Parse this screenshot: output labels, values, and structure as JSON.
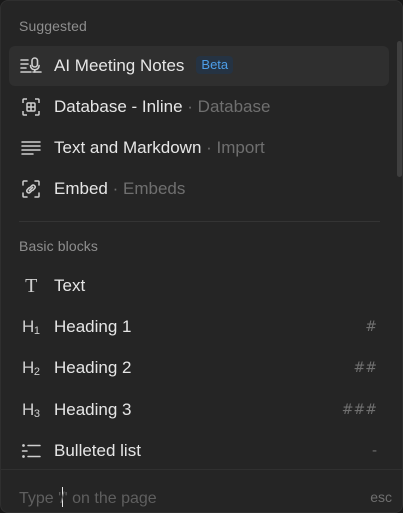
{
  "sections": {
    "suggested": "Suggested",
    "basic_blocks": "Basic blocks"
  },
  "suggested_items": [
    {
      "label": "AI Meeting Notes",
      "badge": "Beta",
      "icon": "meeting-notes-icon"
    },
    {
      "label": "Database - Inline",
      "separator": "·",
      "meta": "Database",
      "icon": "database-inline-icon"
    },
    {
      "label": "Text and Markdown",
      "separator": "·",
      "meta": "Import",
      "icon": "lines-icon"
    },
    {
      "label": "Embed",
      "separator": "·",
      "meta": "Embeds",
      "icon": "embed-link-icon"
    }
  ],
  "basic_items": [
    {
      "label": "Text",
      "icon_text": "T",
      "shortcut": "",
      "icon": "text-icon"
    },
    {
      "label": "Heading 1",
      "icon_text": "H",
      "icon_sub": "1",
      "shortcut": "#",
      "icon": "heading-1-icon"
    },
    {
      "label": "Heading 2",
      "icon_text": "H",
      "icon_sub": "2",
      "shortcut": "##",
      "icon": "heading-2-icon"
    },
    {
      "label": "Heading 3",
      "icon_text": "H",
      "icon_sub": "3",
      "shortcut": "###",
      "icon": "heading-3-icon"
    },
    {
      "label": "Bulleted list",
      "shortcut": "-",
      "icon": "bulleted-list-icon"
    }
  ],
  "footer": {
    "hint_before": "Type '",
    "hint_slash": "/",
    "hint_after": "' on the page",
    "esc": "esc"
  },
  "colors": {
    "background": "#252525",
    "selected": "#2f2f2f",
    "badge_bg": "#253343",
    "badge_text": "#4d9ee8"
  }
}
